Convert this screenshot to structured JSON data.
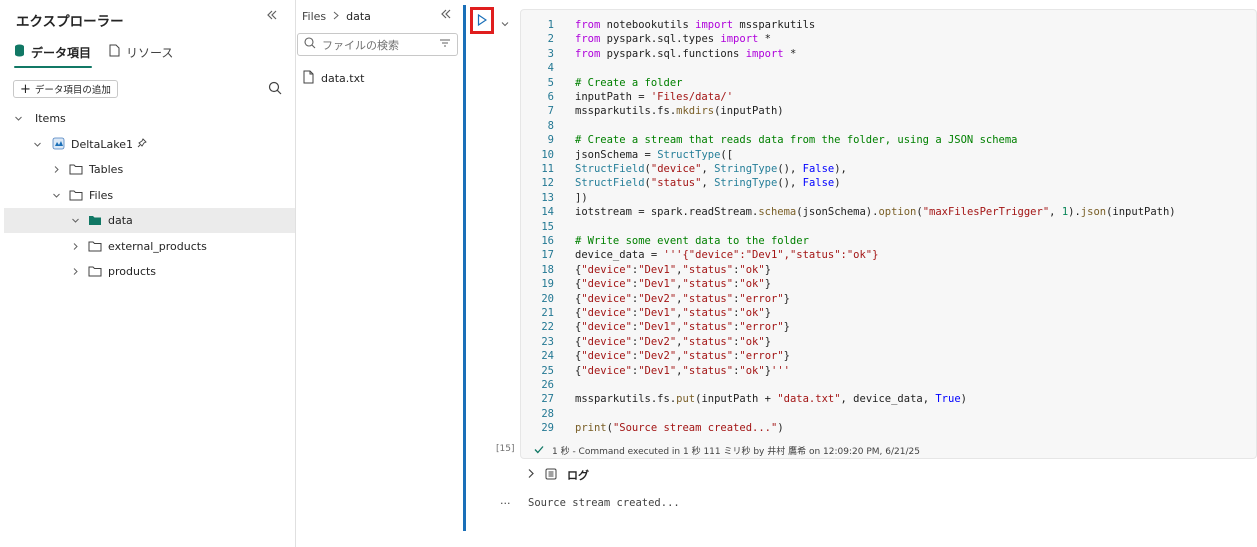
{
  "explorer": {
    "title": "エクスプローラー",
    "tabs": [
      {
        "label": "データ項目",
        "active": true
      },
      {
        "label": "リソース",
        "active": false
      }
    ],
    "add_button_label": "データ項目の追加",
    "tree": [
      {
        "label": "Items",
        "expanded": true
      },
      {
        "label": "DeltaLake1",
        "expanded": true,
        "pinned": true
      },
      {
        "label": "Tables",
        "expanded": false
      },
      {
        "label": "Files",
        "expanded": true
      },
      {
        "label": "data",
        "expanded": true,
        "selected": true
      },
      {
        "label": "external_products",
        "expanded": false
      },
      {
        "label": "products",
        "expanded": false
      }
    ]
  },
  "files": {
    "breadcrumb": [
      "Files",
      "data"
    ],
    "search_placeholder": "ファイルの検索",
    "items": [
      {
        "name": "data.txt"
      }
    ]
  },
  "notebook": {
    "code_lines": [
      {
        "n": "1",
        "text": "from notebookutils import mssparkutils"
      },
      {
        "n": "2",
        "text": "from pyspark.sql.types import *"
      },
      {
        "n": "3",
        "text": "from pyspark.sql.functions import *"
      },
      {
        "n": "4",
        "text": ""
      },
      {
        "n": "5",
        "text": "# Create a folder"
      },
      {
        "n": "6",
        "text": "inputPath = 'Files/data/'"
      },
      {
        "n": "7",
        "text": "mssparkutils.fs.mkdirs(inputPath)"
      },
      {
        "n": "8",
        "text": ""
      },
      {
        "n": "9",
        "text": "# Create a stream that reads data from the folder, using a JSON schema"
      },
      {
        "n": "10",
        "text": "jsonSchema = StructType(["
      },
      {
        "n": "11",
        "text": "StructField(\"device\", StringType(), False),"
      },
      {
        "n": "12",
        "text": "StructField(\"status\", StringType(), False)"
      },
      {
        "n": "13",
        "text": "])"
      },
      {
        "n": "14",
        "text": "iotstream = spark.readStream.schema(jsonSchema).option(\"maxFilesPerTrigger\", 1).json(inputPath)"
      },
      {
        "n": "15",
        "text": ""
      },
      {
        "n": "16",
        "text": "# Write some event data to the folder"
      },
      {
        "n": "17",
        "text": "device_data = '''{\"device\":\"Dev1\",\"status\":\"ok\"}"
      },
      {
        "n": "18",
        "text": "{\"device\":\"Dev1\",\"status\":\"ok\"}"
      },
      {
        "n": "19",
        "text": "{\"device\":\"Dev1\",\"status\":\"ok\"}"
      },
      {
        "n": "20",
        "text": "{\"device\":\"Dev2\",\"status\":\"error\"}"
      },
      {
        "n": "21",
        "text": "{\"device\":\"Dev1\",\"status\":\"ok\"}"
      },
      {
        "n": "22",
        "text": "{\"device\":\"Dev1\",\"status\":\"error\"}"
      },
      {
        "n": "23",
        "text": "{\"device\":\"Dev2\",\"status\":\"ok\"}"
      },
      {
        "n": "24",
        "text": "{\"device\":\"Dev2\",\"status\":\"error\"}"
      },
      {
        "n": "25",
        "text": "{\"device\":\"Dev1\",\"status\":\"ok\"}'''"
      },
      {
        "n": "26",
        "text": ""
      },
      {
        "n": "27",
        "text": "mssparkutils.fs.put(inputPath + \"data.txt\", device_data, True)"
      },
      {
        "n": "28",
        "text": ""
      },
      {
        "n": "29",
        "text": "print(\"Source stream created...\")"
      }
    ],
    "execution_count": "[15]",
    "execution_status": "1 秒 - Command executed in 1 秒 111 ミリ秒 by 井村 鷹希 on 12:09:20 PM, 6/21/25",
    "log_label": "ログ",
    "output_dots": "...",
    "output_text": "Source stream created..."
  },
  "colors": {
    "accent": "#117865",
    "cell_bar": "#1a6fb8",
    "run_highlight": "#e01e1e"
  }
}
